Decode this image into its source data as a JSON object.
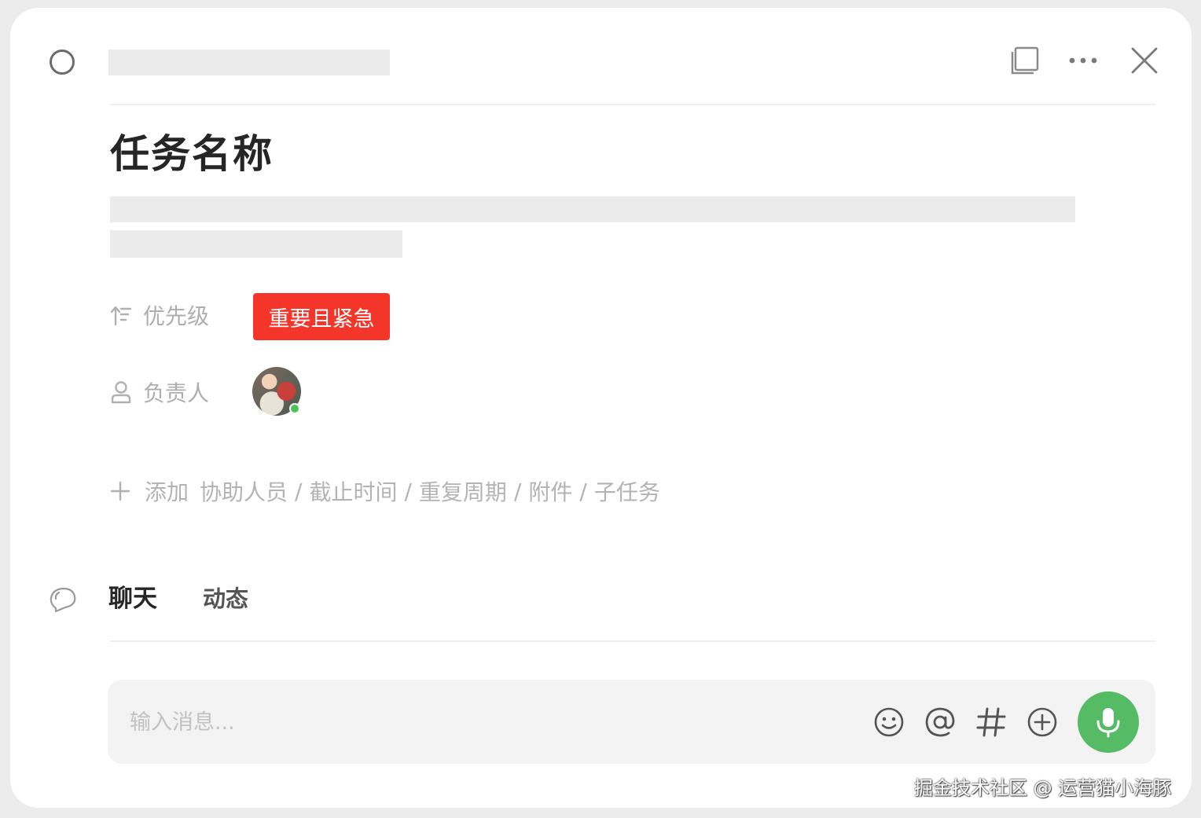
{
  "task": {
    "title": "任务名称"
  },
  "properties": {
    "priority_label": "优先级",
    "priority_value": "重要且紧急",
    "assignee_label": "负责人"
  },
  "add_row": {
    "add": "添加",
    "options": [
      "协助人员",
      "截止时间",
      "重复周期",
      "附件",
      "子任务"
    ],
    "separator": "/"
  },
  "tabs": {
    "chat": "聊天",
    "activity": "动态"
  },
  "composer": {
    "placeholder": "输入消息..."
  },
  "colors": {
    "priority_badge": "#f4362a",
    "mic_button": "#55bb65",
    "online_status": "#4cc35a"
  },
  "icons": {
    "header": [
      "status-circle-icon",
      "open-window-icon",
      "more-icon",
      "close-icon"
    ],
    "composer_tools": [
      "emoji-icon",
      "mention-icon",
      "hashtag-icon",
      "add-attachment-icon",
      "microphone-icon"
    ]
  },
  "watermark": "掘金技术社区 @ 运营猫小海豚"
}
